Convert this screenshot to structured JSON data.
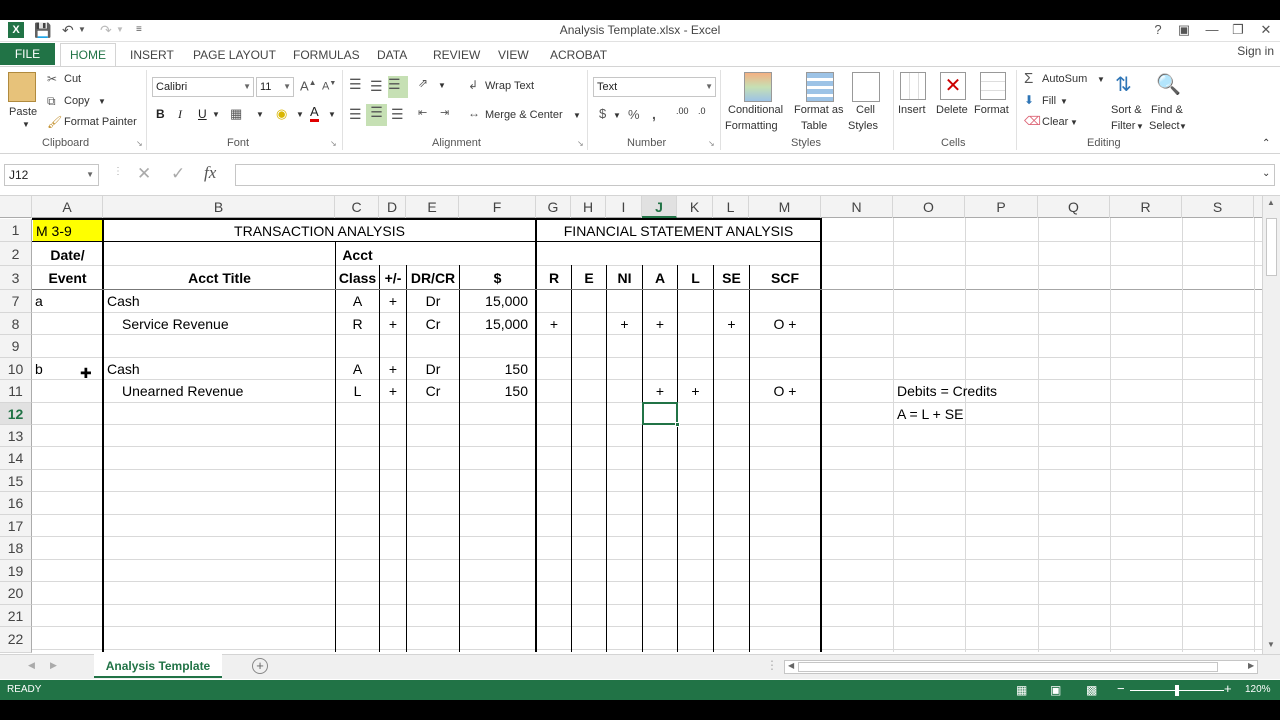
{
  "window": {
    "title": "Analysis Template.xlsx - Excel",
    "help": "?",
    "signin": "Sign in"
  },
  "tabs": [
    "FILE",
    "HOME",
    "INSERT",
    "PAGE LAYOUT",
    "FORMULAS",
    "DATA",
    "REVIEW",
    "VIEW",
    "ACROBAT"
  ],
  "ribbon": {
    "clipboard": {
      "paste": "Paste",
      "cut": "Cut",
      "copy": "Copy",
      "format_painter": "Format Painter",
      "label": "Clipboard"
    },
    "font": {
      "name": "Calibri",
      "size": "11",
      "label": "Font"
    },
    "alignment": {
      "wrap": "Wrap Text",
      "merge": "Merge & Center",
      "label": "Alignment"
    },
    "number": {
      "format": "Text",
      "label": "Number"
    },
    "styles": {
      "conditional": "Conditional",
      "conditional2": "Formatting",
      "format_as": "Format as",
      "format_as2": "Table",
      "cell": "Cell",
      "cell2": "Styles",
      "label": "Styles"
    },
    "cells": {
      "insert": "Insert",
      "delete": "Delete",
      "format": "Format",
      "label": "Cells"
    },
    "editing": {
      "autosum": "AutoSum",
      "fill": "Fill",
      "clear": "Clear",
      "sort": "Sort &",
      "sort2": "Filter",
      "find": "Find &",
      "find2": "Select",
      "label": "Editing"
    }
  },
  "formula_bar": {
    "name_box": "J12",
    "fx": "fx",
    "value": ""
  },
  "columns": [
    "A",
    "B",
    "C",
    "D",
    "E",
    "F",
    "G",
    "H",
    "I",
    "J",
    "K",
    "L",
    "M",
    "N",
    "O",
    "P",
    "Q",
    "R",
    "S"
  ],
  "rows": [
    "1",
    "2",
    "3",
    "7",
    "8",
    "9",
    "10",
    "11",
    "12",
    "13",
    "14",
    "15",
    "16",
    "17",
    "18",
    "19",
    "20",
    "21",
    "22"
  ],
  "cells": {
    "a1": "M 3-9",
    "b1": "TRANSACTION ANALYSIS",
    "g1": "FINANCIAL STATEMENT ANALYSIS",
    "a2": "Date/",
    "c2": "Acct",
    "a3": "Event",
    "b3": "Acct Title",
    "c3": "Class",
    "d3": "+/-",
    "e3": "DR/CR",
    "f3": "$",
    "g3": "R",
    "h3": "E",
    "i3": "NI",
    "j3": "A",
    "k3": "L",
    "l3": "SE",
    "m3": "SCF",
    "a7": "a",
    "b7": "Cash",
    "c7": "A",
    "d7": "+",
    "e7": "Dr",
    "f7": "15,000",
    "b8": "Service Revenue",
    "c8": "R",
    "d8": "+",
    "e8": "Cr",
    "f8": "15,000",
    "g8": "+",
    "i8": "+",
    "j8": "+",
    "l8": "+",
    "m8": "O +",
    "a10": "b",
    "b10": "Cash",
    "c10": "A",
    "d10": "+",
    "e10": "Dr",
    "f10": "150",
    "b11": "Unearned Revenue",
    "c11": "L",
    "d11": "+",
    "e11": "Cr",
    "f11": "150",
    "j11": "+",
    "k11": "+",
    "m11": "O +",
    "o11": "Debits = Credits",
    "o12": "A = L + SE"
  },
  "sheet_tab": "Analysis Template",
  "status": {
    "ready": "READY",
    "zoom": "120%"
  },
  "colors": {
    "excel_green": "#217346",
    "highlight_yellow": "#ffff00"
  }
}
